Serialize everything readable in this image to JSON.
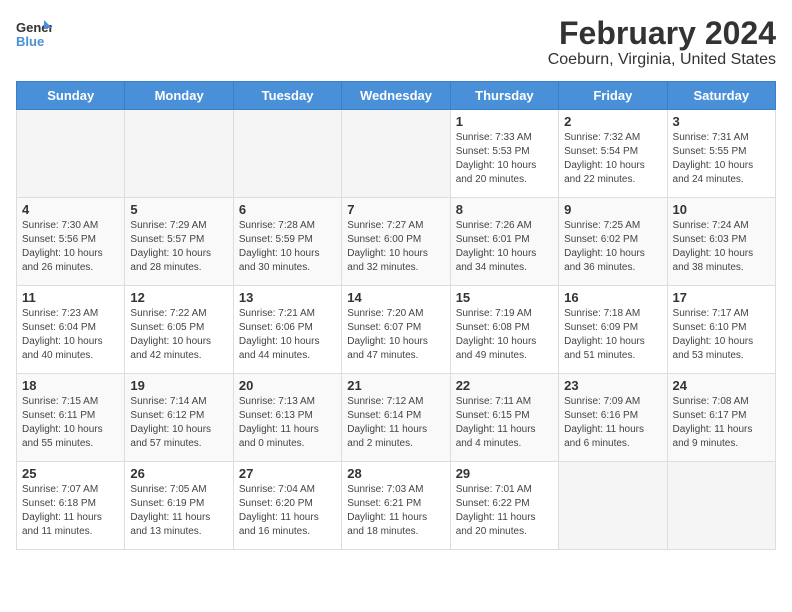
{
  "header": {
    "logo_line1": "General",
    "logo_line2": "Blue",
    "title": "February 2024",
    "subtitle": "Coeburn, Virginia, United States"
  },
  "days_of_week": [
    "Sunday",
    "Monday",
    "Tuesday",
    "Wednesday",
    "Thursday",
    "Friday",
    "Saturday"
  ],
  "weeks": [
    [
      {
        "day": "",
        "info": ""
      },
      {
        "day": "",
        "info": ""
      },
      {
        "day": "",
        "info": ""
      },
      {
        "day": "",
        "info": ""
      },
      {
        "day": "1",
        "info": "Sunrise: 7:33 AM\nSunset: 5:53 PM\nDaylight: 10 hours\nand 20 minutes."
      },
      {
        "day": "2",
        "info": "Sunrise: 7:32 AM\nSunset: 5:54 PM\nDaylight: 10 hours\nand 22 minutes."
      },
      {
        "day": "3",
        "info": "Sunrise: 7:31 AM\nSunset: 5:55 PM\nDaylight: 10 hours\nand 24 minutes."
      }
    ],
    [
      {
        "day": "4",
        "info": "Sunrise: 7:30 AM\nSunset: 5:56 PM\nDaylight: 10 hours\nand 26 minutes."
      },
      {
        "day": "5",
        "info": "Sunrise: 7:29 AM\nSunset: 5:57 PM\nDaylight: 10 hours\nand 28 minutes."
      },
      {
        "day": "6",
        "info": "Sunrise: 7:28 AM\nSunset: 5:59 PM\nDaylight: 10 hours\nand 30 minutes."
      },
      {
        "day": "7",
        "info": "Sunrise: 7:27 AM\nSunset: 6:00 PM\nDaylight: 10 hours\nand 32 minutes."
      },
      {
        "day": "8",
        "info": "Sunrise: 7:26 AM\nSunset: 6:01 PM\nDaylight: 10 hours\nand 34 minutes."
      },
      {
        "day": "9",
        "info": "Sunrise: 7:25 AM\nSunset: 6:02 PM\nDaylight: 10 hours\nand 36 minutes."
      },
      {
        "day": "10",
        "info": "Sunrise: 7:24 AM\nSunset: 6:03 PM\nDaylight: 10 hours\nand 38 minutes."
      }
    ],
    [
      {
        "day": "11",
        "info": "Sunrise: 7:23 AM\nSunset: 6:04 PM\nDaylight: 10 hours\nand 40 minutes."
      },
      {
        "day": "12",
        "info": "Sunrise: 7:22 AM\nSunset: 6:05 PM\nDaylight: 10 hours\nand 42 minutes."
      },
      {
        "day": "13",
        "info": "Sunrise: 7:21 AM\nSunset: 6:06 PM\nDaylight: 10 hours\nand 44 minutes."
      },
      {
        "day": "14",
        "info": "Sunrise: 7:20 AM\nSunset: 6:07 PM\nDaylight: 10 hours\nand 47 minutes."
      },
      {
        "day": "15",
        "info": "Sunrise: 7:19 AM\nSunset: 6:08 PM\nDaylight: 10 hours\nand 49 minutes."
      },
      {
        "day": "16",
        "info": "Sunrise: 7:18 AM\nSunset: 6:09 PM\nDaylight: 10 hours\nand 51 minutes."
      },
      {
        "day": "17",
        "info": "Sunrise: 7:17 AM\nSunset: 6:10 PM\nDaylight: 10 hours\nand 53 minutes."
      }
    ],
    [
      {
        "day": "18",
        "info": "Sunrise: 7:15 AM\nSunset: 6:11 PM\nDaylight: 10 hours\nand 55 minutes."
      },
      {
        "day": "19",
        "info": "Sunrise: 7:14 AM\nSunset: 6:12 PM\nDaylight: 10 hours\nand 57 minutes."
      },
      {
        "day": "20",
        "info": "Sunrise: 7:13 AM\nSunset: 6:13 PM\nDaylight: 11 hours\nand 0 minutes."
      },
      {
        "day": "21",
        "info": "Sunrise: 7:12 AM\nSunset: 6:14 PM\nDaylight: 11 hours\nand 2 minutes."
      },
      {
        "day": "22",
        "info": "Sunrise: 7:11 AM\nSunset: 6:15 PM\nDaylight: 11 hours\nand 4 minutes."
      },
      {
        "day": "23",
        "info": "Sunrise: 7:09 AM\nSunset: 6:16 PM\nDaylight: 11 hours\nand 6 minutes."
      },
      {
        "day": "24",
        "info": "Sunrise: 7:08 AM\nSunset: 6:17 PM\nDaylight: 11 hours\nand 9 minutes."
      }
    ],
    [
      {
        "day": "25",
        "info": "Sunrise: 7:07 AM\nSunset: 6:18 PM\nDaylight: 11 hours\nand 11 minutes."
      },
      {
        "day": "26",
        "info": "Sunrise: 7:05 AM\nSunset: 6:19 PM\nDaylight: 11 hours\nand 13 minutes."
      },
      {
        "day": "27",
        "info": "Sunrise: 7:04 AM\nSunset: 6:20 PM\nDaylight: 11 hours\nand 16 minutes."
      },
      {
        "day": "28",
        "info": "Sunrise: 7:03 AM\nSunset: 6:21 PM\nDaylight: 11 hours\nand 18 minutes."
      },
      {
        "day": "29",
        "info": "Sunrise: 7:01 AM\nSunset: 6:22 PM\nDaylight: 11 hours\nand 20 minutes."
      },
      {
        "day": "",
        "info": ""
      },
      {
        "day": "",
        "info": ""
      }
    ]
  ]
}
